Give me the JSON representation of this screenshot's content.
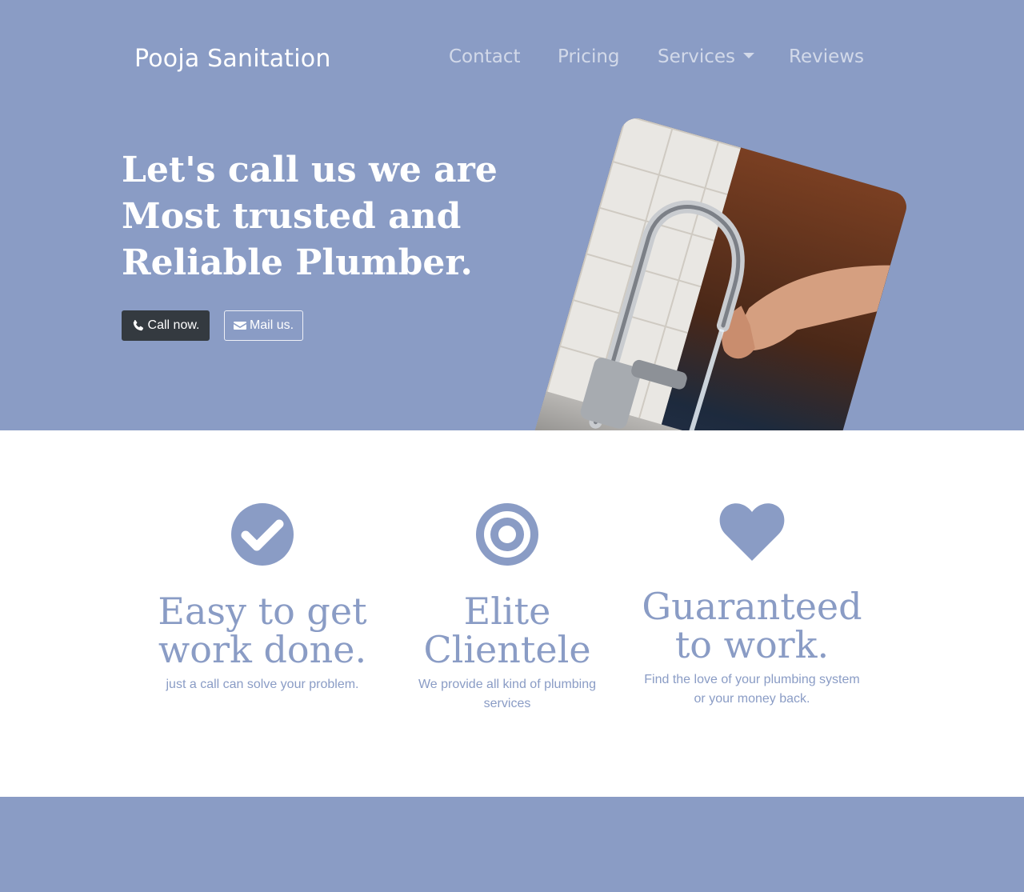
{
  "brand": {
    "name": "Pooja Sanitation"
  },
  "nav": {
    "items": [
      {
        "label": "Contact"
      },
      {
        "label": "Pricing"
      },
      {
        "label": "Services"
      },
      {
        "label": "Reviews"
      }
    ]
  },
  "hero": {
    "headline": "Let's call us we are Most trusted and Reliable Plumber.",
    "call_button": {
      "label": "Call now.",
      "icon": "phone-icon"
    },
    "mail_button": {
      "label": "Mail us.",
      "icon": "envelope-icon"
    },
    "image": "faucet-photo"
  },
  "features": [
    {
      "icon": "check-circle-icon",
      "title": "Easy to get work done.",
      "text": "just a call can solve your problem."
    },
    {
      "icon": "target-icon",
      "title": "Elite Clientele",
      "text": "We provide all kind of plumbing services"
    },
    {
      "icon": "heart-icon",
      "title": "Guaranteed to work.",
      "text": "Find the love of your plumbing system or your money back."
    }
  ],
  "colors": {
    "primary": "#8a9cc5",
    "dark_button": "#343a40",
    "white": "#ffffff"
  }
}
